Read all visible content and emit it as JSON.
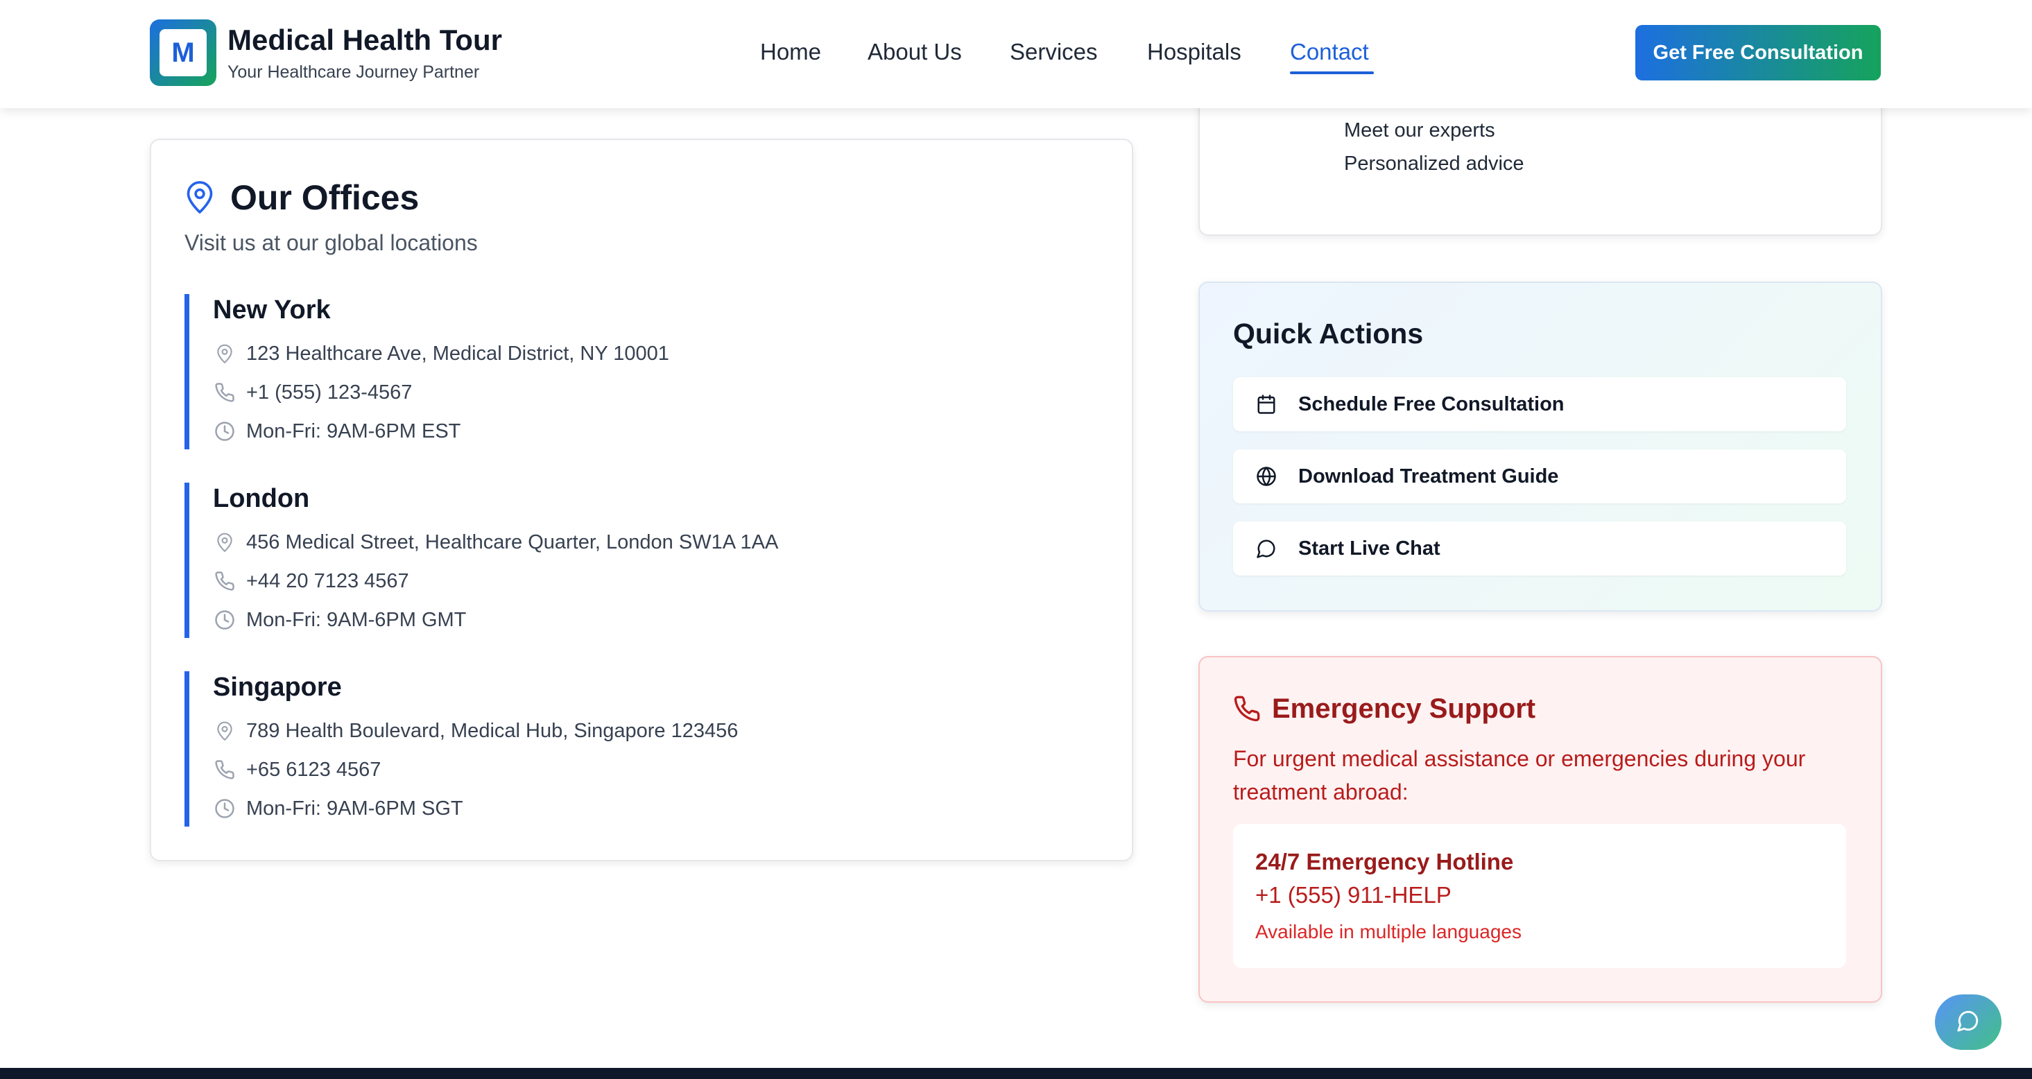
{
  "brand": {
    "logo_letter": "M",
    "title": "Medical Health Tour",
    "subtitle": "Your Healthcare Journey Partner"
  },
  "nav": {
    "items": [
      {
        "label": "Home"
      },
      {
        "label": "About Us"
      },
      {
        "label": "Services"
      },
      {
        "label": "Hospitals"
      },
      {
        "label": "Contact",
        "active": true
      }
    ],
    "cta_label": "Get Free Consultation"
  },
  "consultation_card": {
    "lines": [
      "Meet our experts",
      "Personalized advice"
    ]
  },
  "offices": {
    "title": "Our Offices",
    "subtitle": "Visit us at our global locations",
    "locations": [
      {
        "city": "New York",
        "address": "123 Healthcare Ave, Medical District, NY 10001",
        "phone": "+1 (555) 123-4567",
        "hours": "Mon-Fri: 9AM-6PM EST"
      },
      {
        "city": "London",
        "address": "456 Medical Street, Healthcare Quarter, London SW1A 1AA",
        "phone": "+44 20 7123 4567",
        "hours": "Mon-Fri: 9AM-6PM GMT"
      },
      {
        "city": "Singapore",
        "address": "789 Health Boulevard, Medical Hub, Singapore 123456",
        "phone": "+65 6123 4567",
        "hours": "Mon-Fri: 9AM-6PM SGT"
      }
    ]
  },
  "quick_actions": {
    "title": "Quick Actions",
    "items": [
      {
        "label": "Schedule Free Consultation",
        "icon": "calendar-icon"
      },
      {
        "label": "Download Treatment Guide",
        "icon": "globe-icon"
      },
      {
        "label": "Start Live Chat",
        "icon": "chat-bubble-icon"
      }
    ]
  },
  "emergency": {
    "title": "Emergency Support",
    "description": "For urgent medical assistance or emergencies during your treatment abroad:",
    "hotline_label": "24/7 Emergency Hotline",
    "hotline_number": "+1 (555) 911-HELP",
    "languages_note": "Available in multiple languages"
  },
  "colors": {
    "primary": "#1d5fd8",
    "accent_green": "#16a35c",
    "office_border": "#2563eb",
    "emergency_text": "#991b1b",
    "emergency_bg": "#fef2f2",
    "footer": "#0f172a"
  }
}
